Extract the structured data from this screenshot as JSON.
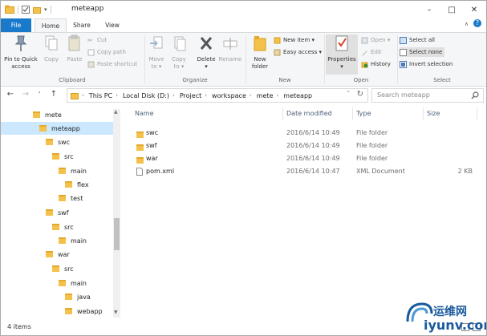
{
  "window": {
    "title": "meteapp",
    "controls": {
      "minimize": "–",
      "maximize": "□",
      "close": "✕"
    }
  },
  "ribbon_tabs": [
    "File",
    "Home",
    "Share",
    "View"
  ],
  "ribbon": {
    "clipboard": {
      "label": "Clipboard",
      "pin": "Pin to Quick\naccess",
      "copy": "Copy",
      "paste": "Paste",
      "cut": "Cut",
      "copy_path": "Copy path",
      "paste_shortcut": "Paste shortcut"
    },
    "organize": {
      "label": "Organize",
      "move_to": "Move\nto ▾",
      "copy_to": "Copy\nto ▾",
      "delete": "Delete\n▾",
      "rename": "Rename"
    },
    "new": {
      "label": "New",
      "new_folder": "New\nfolder",
      "new_item": "New item ▾",
      "easy_access": "Easy access ▾"
    },
    "open": {
      "label": "Open",
      "properties": "Properties\n▾",
      "open": "Open ▾",
      "edit": "Edit",
      "history": "History"
    },
    "select": {
      "label": "Select",
      "select_all": "Select all",
      "select_none": "Select none",
      "invert": "Invert selection"
    }
  },
  "address": {
    "crumbs": [
      "This PC",
      "Local Disk (D:)",
      "Project",
      "workspace",
      "mete",
      "meteapp"
    ],
    "search_placeholder": "Search meteapp"
  },
  "tree": [
    {
      "label": "mete",
      "selected": false
    },
    {
      "label": "meteapp",
      "selected": true
    },
    {
      "label": "swc",
      "selected": false
    },
    {
      "label": "src",
      "selected": false
    },
    {
      "label": "main",
      "selected": false
    },
    {
      "label": "flex",
      "selected": false
    },
    {
      "label": "test",
      "selected": false
    },
    {
      "label": "swf",
      "selected": false
    },
    {
      "label": "src",
      "selected": false
    },
    {
      "label": "main",
      "selected": false
    },
    {
      "label": "war",
      "selected": false
    },
    {
      "label": "src",
      "selected": false
    },
    {
      "label": "main",
      "selected": false
    },
    {
      "label": "java",
      "selected": false
    },
    {
      "label": "webapp",
      "selected": false
    }
  ],
  "columns": [
    "Name",
    "Date modified",
    "Type",
    "Size"
  ],
  "files": [
    {
      "name": "swc",
      "date": "2016/6/14 10:49",
      "type": "File folder",
      "size": "",
      "kind": "folder"
    },
    {
      "name": "swf",
      "date": "2016/6/14 10:49",
      "type": "File folder",
      "size": "",
      "kind": "folder"
    },
    {
      "name": "war",
      "date": "2016/6/14 10:49",
      "type": "File folder",
      "size": "",
      "kind": "folder"
    },
    {
      "name": "pom.xml",
      "date": "2016/6/14 10:47",
      "type": "XML Document",
      "size": "2 KB",
      "kind": "file"
    }
  ],
  "status": {
    "count": "4 items"
  },
  "watermark": {
    "line1": "运维网",
    "line2": "iyunv.com"
  },
  "colors": {
    "file_tab": "#1979ca",
    "selection": "#cce8ff",
    "folder": "#f4c24a",
    "watermark": "#1a5a9e"
  }
}
